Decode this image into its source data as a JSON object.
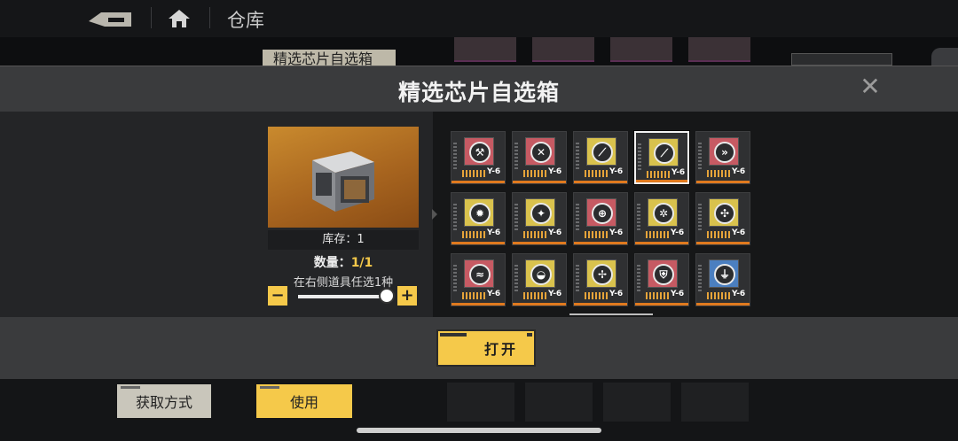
{
  "header": {
    "page_title": "仓库",
    "bg_tab_label": "精选芯片自选箱"
  },
  "modal": {
    "title": "精选芯片自选箱",
    "close_icon": "close-icon",
    "item": {
      "stock_label": "库存：1",
      "qty_label": "数量：",
      "qty_value": "1/1",
      "hint": "在右侧道具任选1种",
      "minus_label": "−",
      "plus_label": "+",
      "slider_value_fraction": 1.0
    },
    "chips": [
      {
        "color": "red",
        "emblem": "wrench",
        "code": "Y-6",
        "selected": false
      },
      {
        "color": "red",
        "emblem": "cross-tools",
        "code": "Y-6",
        "selected": false
      },
      {
        "color": "yellow",
        "emblem": "pen-strike",
        "code": "Y-6",
        "selected": false
      },
      {
        "color": "yellow",
        "emblem": "pen-strike",
        "code": "Y-6",
        "selected": true
      },
      {
        "color": "red",
        "emblem": "chevrons",
        "code": "Y-6",
        "selected": false
      },
      {
        "color": "yellow",
        "emblem": "fire",
        "code": "Y-6",
        "selected": false
      },
      {
        "color": "yellow",
        "emblem": "sparkle",
        "code": "Y-6",
        "selected": false
      },
      {
        "color": "red",
        "emblem": "target",
        "code": "Y-6",
        "selected": false
      },
      {
        "color": "yellow",
        "emblem": "gear-target",
        "code": "Y-6",
        "selected": false
      },
      {
        "color": "yellow",
        "emblem": "compass",
        "code": "Y-6",
        "selected": false
      },
      {
        "color": "red",
        "emblem": "wave",
        "code": "Y-6",
        "selected": false
      },
      {
        "color": "yellow",
        "emblem": "drop-wave",
        "code": "Y-6",
        "selected": false
      },
      {
        "color": "yellow",
        "emblem": "leaf",
        "code": "Y-6",
        "selected": false
      },
      {
        "color": "red",
        "emblem": "shield",
        "code": "Y-6",
        "selected": false
      },
      {
        "color": "blue",
        "emblem": "boot",
        "code": "Y-6",
        "selected": false
      }
    ],
    "open_button": "打开"
  },
  "bottom": {
    "acquire_button": "获取方式",
    "use_button": "使用"
  },
  "colors": {
    "accent_yellow": "#f5c94a",
    "chip_red": "#c65a63",
    "chip_yellow": "#d9c24d",
    "chip_blue": "#4b7fc0",
    "strip_orange": "#e07a1e"
  }
}
